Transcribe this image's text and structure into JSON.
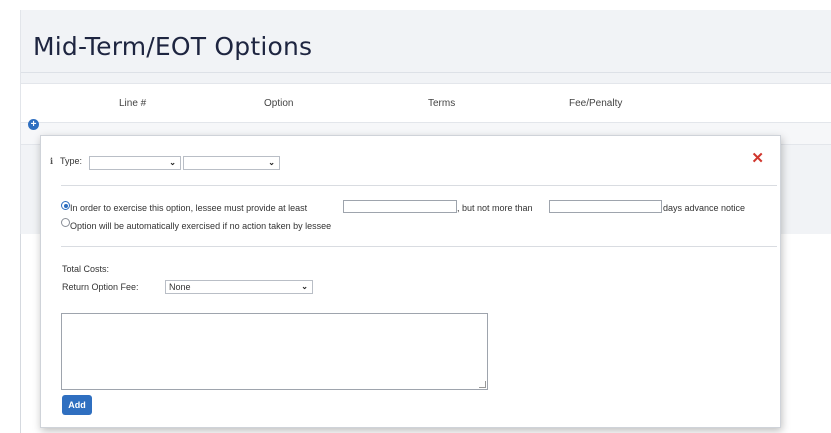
{
  "page": {
    "title": "Mid-Term/EOT Options"
  },
  "grid": {
    "columns": [
      "Line #",
      "Option",
      "Terms",
      "Fee/Penalty"
    ]
  },
  "modal": {
    "type_label": "Type:",
    "type_select_1": "",
    "type_select_2": "",
    "option_notice_text_1": "In order to exercise this option, lessee must provide at least",
    "notice_min_value": "",
    "option_notice_text_2": ", but not more than",
    "notice_max_value": "",
    "option_notice_text_3": "days advance notice",
    "option_auto_text": "Option will be automatically exercised if no action taken by lessee",
    "total_costs_label": "Total Costs:",
    "return_fee_label": "Return Option Fee:",
    "return_fee_value": "None",
    "notes_value": "",
    "add_button_label": "Add"
  },
  "colors": {
    "accent": "#2f6fc0",
    "close": "#d0362d",
    "title": "#1e2540"
  }
}
